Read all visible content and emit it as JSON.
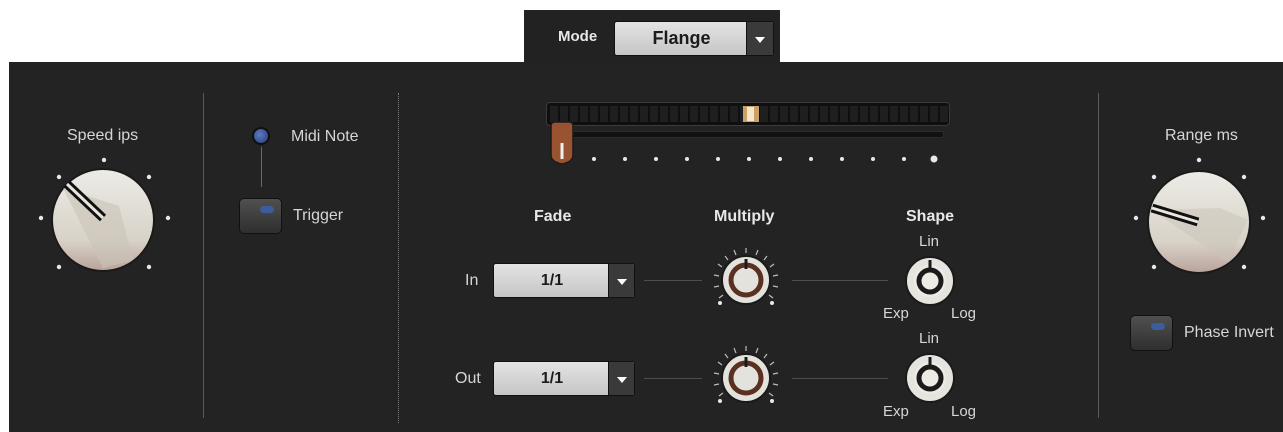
{
  "mode": {
    "label": "Mode",
    "value": "Flange"
  },
  "speed": {
    "label": "Speed ips"
  },
  "midi": {
    "label": "Midi Note"
  },
  "trigger": {
    "label": "Trigger"
  },
  "fade": {
    "header": "Fade",
    "in_label": "In",
    "in_value": "1/1",
    "out_label": "Out",
    "out_value": "1/1"
  },
  "multiply": {
    "header": "Multiply"
  },
  "shape": {
    "header": "Shape",
    "in": {
      "lin": "Lin",
      "exp": "Exp",
      "log": "Log"
    },
    "out": {
      "lin": "Lin",
      "exp": "Exp",
      "log": "Log"
    }
  },
  "range": {
    "label": "Range ms"
  },
  "phase_invert": {
    "label": "Phase Invert"
  }
}
